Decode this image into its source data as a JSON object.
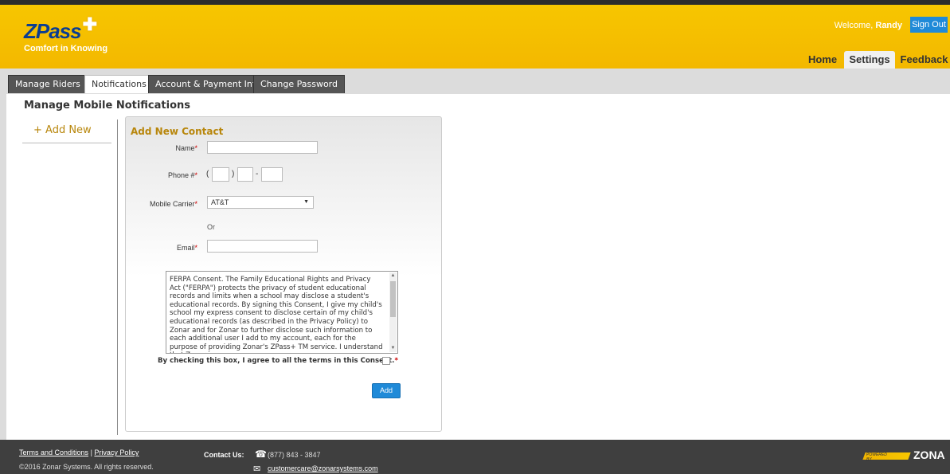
{
  "brand": {
    "name": "ZPass",
    "tagline": "Comfort in Knowing"
  },
  "header": {
    "welcome_prefix": "Welcome,",
    "user_name": "Randy",
    "sign_out": "Sign Out"
  },
  "nav": {
    "home": "Home",
    "settings": "Settings",
    "feedback": "Feedback"
  },
  "subtabs": {
    "manage_riders": "Manage Riders",
    "notifications": "Notifications",
    "account_payment": "Account & Payment Info",
    "change_password": "Change Password"
  },
  "page": {
    "title": "Manage Mobile Notifications",
    "add_new": "+ Add New"
  },
  "form": {
    "title": "Add New Contact",
    "name_label": "Name",
    "phone_label": "Phone #",
    "carrier_label": "Mobile Carrier",
    "carrier_value": "AT&T",
    "or_text": "Or",
    "email_label": "Email",
    "required_mark": "*",
    "phone_open": "(",
    "phone_close": ")",
    "phone_dash": "-",
    "consent_text": "FERPA Consent. The Family Educational Rights and Privacy Act (\"FERPA\") protects the privacy of student educational records and limits when a school may disclose a student's educational records. By signing this Consent, I give my child's school my express consent to disclose certain of my child's educational records (as described in the Privacy Policy) to Zonar and for Zonar to further disclose such information to each additional user I add to my account, each for the purpose of providing Zonar's ZPass+ TM service. I understand that Zonar is",
    "agree_text": "By checking this box, I agree to all the terms in this Consent.",
    "add_button": "Add"
  },
  "footer": {
    "terms": "Terms and Conditions",
    "separator": "|",
    "privacy": "Privacy Policy",
    "copyright": "©2016 Zonar Systems. All rights reserved.",
    "contact_label": "Contact Us:",
    "phone": "(877) 843 - 3847",
    "email": "customercare@zonarsystems.com",
    "powered_by": "POWERED BY",
    "logo_text": "ZONA"
  },
  "colors": {
    "header_yellow": "#f5bf00",
    "brand_blue": "#0a3d91",
    "accent_blue": "#1f8ad8",
    "section_gold": "#b8860b",
    "footer_dark": "#3f3f3f"
  }
}
